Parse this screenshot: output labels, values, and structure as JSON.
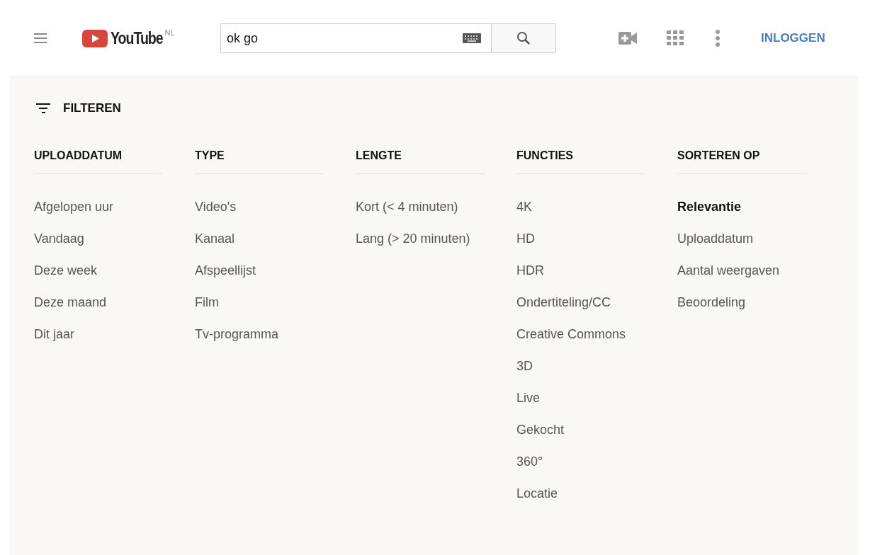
{
  "header": {
    "logo_text": "YouTube",
    "region": "NL",
    "search": {
      "value": "ok go"
    },
    "signin_label": "INLOGGEN"
  },
  "filter_panel": {
    "toggle_label": "FILTEREN",
    "columns": [
      {
        "heading": "UPLOADDATUM",
        "items": [
          {
            "label": "Afgelopen uur",
            "selected": false
          },
          {
            "label": "Vandaag",
            "selected": false
          },
          {
            "label": "Deze week",
            "selected": false
          },
          {
            "label": "Deze maand",
            "selected": false
          },
          {
            "label": "Dit jaar",
            "selected": false
          }
        ]
      },
      {
        "heading": "TYPE",
        "items": [
          {
            "label": "Video's",
            "selected": false
          },
          {
            "label": "Kanaal",
            "selected": false
          },
          {
            "label": "Afspeellijst",
            "selected": false
          },
          {
            "label": "Film",
            "selected": false
          },
          {
            "label": "Tv-programma",
            "selected": false
          }
        ]
      },
      {
        "heading": "LENGTE",
        "items": [
          {
            "label": "Kort (< 4 minuten)",
            "selected": false
          },
          {
            "label": "Lang (> 20 minuten)",
            "selected": false
          }
        ]
      },
      {
        "heading": "FUNCTIES",
        "items": [
          {
            "label": "4K",
            "selected": false
          },
          {
            "label": "HD",
            "selected": false
          },
          {
            "label": "HDR",
            "selected": false
          },
          {
            "label": "Ondertiteling/CC",
            "selected": false
          },
          {
            "label": "Creative Commons",
            "selected": false
          },
          {
            "label": "3D",
            "selected": false
          },
          {
            "label": "Live",
            "selected": false
          },
          {
            "label": "Gekocht",
            "selected": false
          },
          {
            "label": "360°",
            "selected": false
          },
          {
            "label": "Locatie",
            "selected": false
          }
        ]
      },
      {
        "heading": "SORTEREN OP",
        "items": [
          {
            "label": "Relevantie",
            "selected": true
          },
          {
            "label": "Uploaddatum",
            "selected": false
          },
          {
            "label": "Aantal weergaven",
            "selected": false
          },
          {
            "label": "Beoordeling",
            "selected": false
          }
        ]
      }
    ]
  }
}
